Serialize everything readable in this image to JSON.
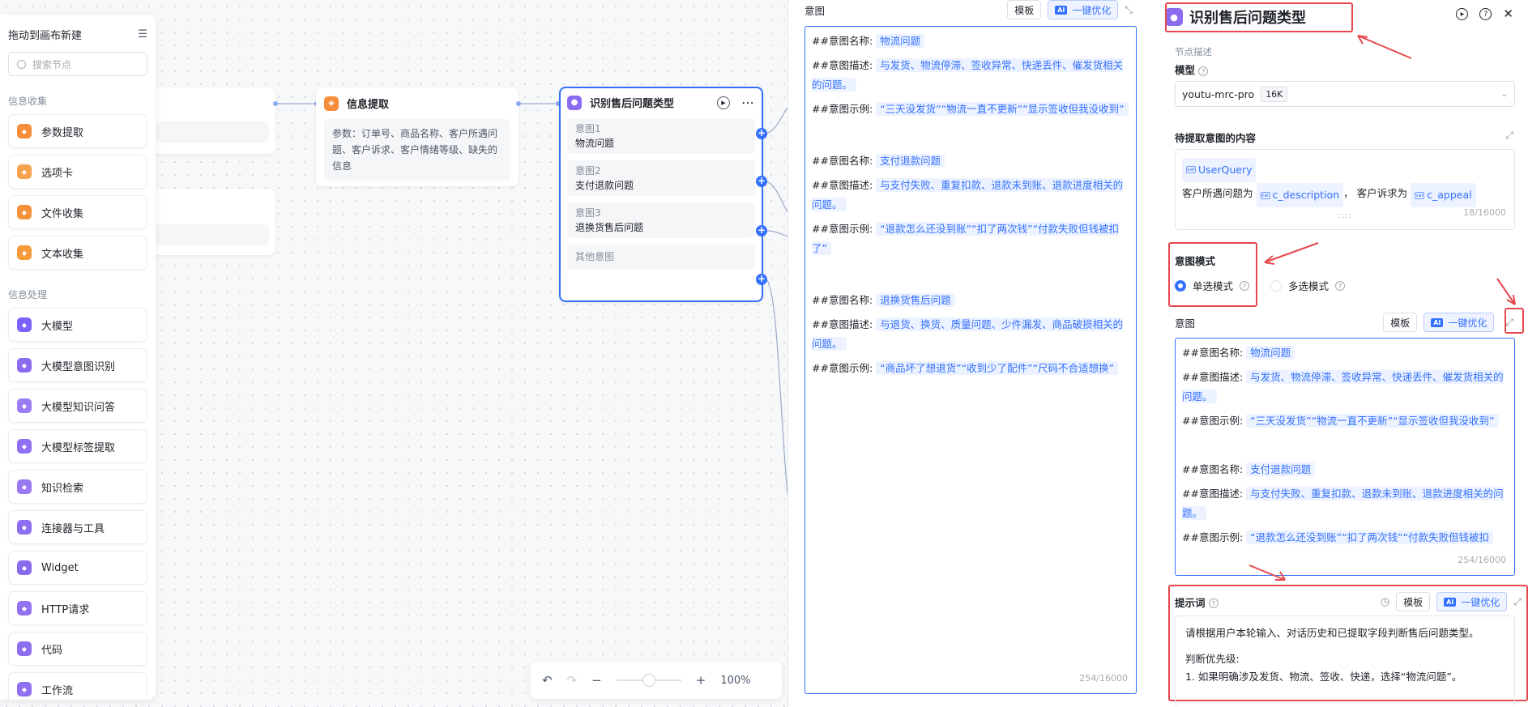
{
  "palette": {
    "title": "拖动到画布新建",
    "search_placeholder": "搜索节点",
    "groups": [
      {
        "label": "信息收集",
        "items": [
          {
            "label": "参数提取",
            "icon": "param-extract-icon",
            "color": "#f78c3a"
          },
          {
            "label": "选项卡",
            "icon": "option-card-icon",
            "color": "#f7a24d"
          },
          {
            "label": "文件收集",
            "icon": "folder-icon",
            "color": "#f7913a"
          },
          {
            "label": "文本收集",
            "icon": "text-collect-icon",
            "color": "#f79a3a"
          }
        ]
      },
      {
        "label": "信息处理",
        "items": [
          {
            "label": "大模型",
            "icon": "sparkle-icon",
            "color": "#7b61ff"
          },
          {
            "label": "大模型意图识别",
            "icon": "robot-icon",
            "color": "#8b6cf0"
          },
          {
            "label": "大模型知识问答",
            "icon": "qa-icon",
            "color": "#9c7bf5"
          },
          {
            "label": "大模型标签提取",
            "icon": "tag-icon",
            "color": "#8f70f2"
          },
          {
            "label": "知识检索",
            "icon": "knowledge-search-icon",
            "color": "#9a78f2"
          },
          {
            "label": "连接器与工具",
            "icon": "connector-icon",
            "color": "#8e6ef0"
          },
          {
            "label": "Widget",
            "icon": "widget-icon",
            "color": "#8a6bf0"
          },
          {
            "label": "HTTP请求",
            "icon": "http-icon",
            "color": "#9272f2"
          },
          {
            "label": "代码",
            "icon": "code-icon",
            "color": "#8d6df0"
          },
          {
            "label": "工作流",
            "icon": "workflow-icon",
            "color": "#8f70f2"
          }
        ]
      }
    ]
  },
  "canvas": {
    "info_node": {
      "title": "信息提取",
      "body": "参数：订单号、商品名称、客户所遇问题、客户诉求、客户情绪等级、缺失的信息"
    },
    "intent_node": {
      "title": "识别售后问题类型",
      "intents": [
        {
          "key": "意图1",
          "value": "物流问题"
        },
        {
          "key": "意图2",
          "value": "支付退款问题"
        },
        {
          "key": "意图3",
          "value": "退换货售后问题"
        }
      ],
      "other": "其他意图"
    },
    "zoom": "100%"
  },
  "editor_panel": {
    "title": "意图",
    "template_btn": "模板",
    "ai_chip": "AI",
    "optimize_btn": "一键优化",
    "counter": "254/16000",
    "blocks": [
      {
        "name_key": "##意图名称:",
        "name": "物流问题",
        "desc_key": "##意图描述:",
        "desc": "与发货、物流停滞、签收异常、快递丢件、催发货相关的问题。",
        "ex_key": "##意图示例:",
        "ex": "“三天没发货”“物流一直不更新”“显示签收但我没收到”"
      },
      {
        "name_key": "##意图名称:",
        "name": "支付退款问题",
        "desc_key": "##意图描述:",
        "desc": "与支付失败、重复扣款、退款未到账、退款进度相关的问题。",
        "ex_key": "##意图示例:",
        "ex": "“退款怎么还没到账”“扣了两次钱”“付款失败但钱被扣了”"
      },
      {
        "name_key": "##意图名称:",
        "name": "退换货售后问题",
        "desc_key": "##意图描述:",
        "desc": "与退货、换货、质量问题、少件漏发、商品破损相关的问题。",
        "ex_key": "##意图示例:",
        "ex": "“商品坏了想退货”“收到少了配件”“尺码不合适想换”"
      }
    ]
  },
  "config": {
    "title": "识别售后问题类型",
    "node_desc_placeholder": "节点描述",
    "model_label": "模型",
    "model_value": "youtu-mrc-pro",
    "model_badge": "16K",
    "content_label": "待提取意图的内容",
    "content": {
      "var1": "UserQuery",
      "text1": "客户所遇问题为",
      "var2": "c_description",
      "sep": "，",
      "text2": "客户诉求为",
      "var3": "c_appeal",
      "counter": "18/16000"
    },
    "mode_label": "意图模式",
    "mode_single": "单选模式",
    "mode_multi": "多选模式",
    "intent_label": "意图",
    "template_btn": "模板",
    "ai_chip": "AI",
    "optimize_btn": "一键优化",
    "intent_counter": "254/16000",
    "intent_blocks": [
      {
        "name_key": "##意图名称:",
        "name": "物流问题",
        "desc_key": "##意图描述:",
        "desc": "与发货、物流停滞、签收异常、快递丢件、催发货相关的问题。",
        "ex_key": "##意图示例:",
        "ex": "“三天没发货”“物流一直不更新”“显示签收但我没收到”"
      },
      {
        "name_key": "##意图名称:",
        "name": "支付退款问题",
        "desc_key": "##意图描述:",
        "desc": "与支付失败、重复扣款、退款未到账、退款进度相关的问题。",
        "ex_key": "##意图示例:",
        "ex": "“退款怎么还没到账”“扣了两次钱”“付款失败但钱被扣"
      }
    ],
    "prompt_label": "提示词",
    "prompt_line1": "请根据用户本轮输入、对话历史和已提取字段判断售后问题类型。",
    "prompt_line2": "判断优先级:",
    "prompt_line3": "1. 如果明确涉及发货、物流、签收、快递，选择“物流问题”。"
  },
  "colors": {
    "accent": "#3370ff",
    "annotation_red": "#e5484d",
    "purple": "#8b6cf0"
  }
}
